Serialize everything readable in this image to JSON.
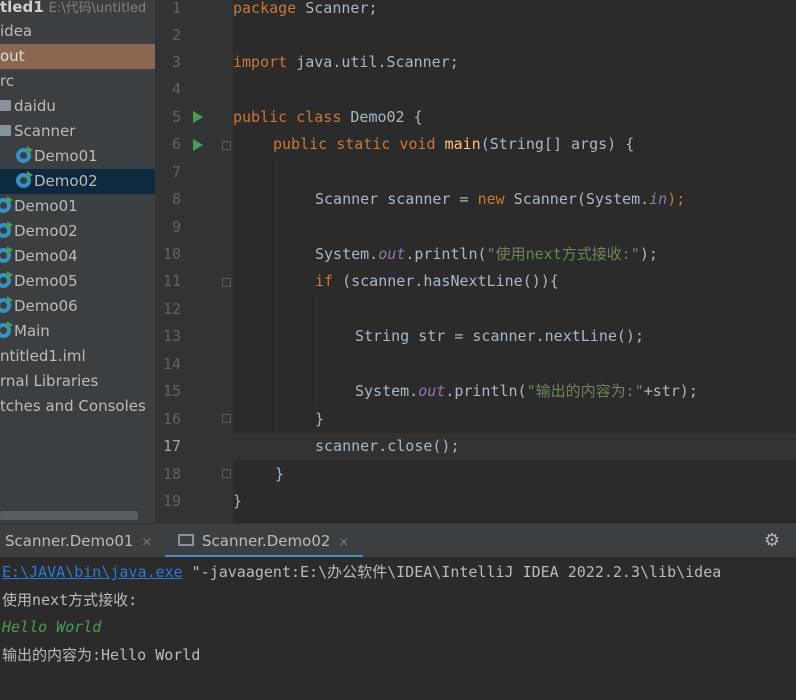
{
  "project_tree": {
    "items": [
      {
        "label": "tled1",
        "path": "E:\\代码\\untitled"
      },
      {
        "label": "idea"
      },
      {
        "label": "out"
      },
      {
        "label": "rc"
      },
      {
        "label": "daidu"
      },
      {
        "label": "Scanner"
      },
      {
        "label": "Demo01"
      },
      {
        "label": "Demo02"
      },
      {
        "label": "Demo01"
      },
      {
        "label": "Demo02"
      },
      {
        "label": "Demo04"
      },
      {
        "label": "Demo05"
      },
      {
        "label": "Demo06"
      },
      {
        "label": "Main"
      },
      {
        "label": "ntitled1.iml"
      },
      {
        "label": "rnal Libraries"
      },
      {
        "label": "tches and Consoles"
      }
    ]
  },
  "editor": {
    "line_numbers": [
      "1",
      "2",
      "3",
      "4",
      "5",
      "6",
      "7",
      "8",
      "9",
      "10",
      "11",
      "12",
      "13",
      "14",
      "15",
      "16",
      "17",
      "18",
      "19"
    ],
    "current_line": "17",
    "code": {
      "l1_kw": "package",
      "l1_rest": " Scanner;",
      "l3_kw": "import",
      "l3_rest": " java.util.Scanner;",
      "l5_kw": "public class",
      "l5_rest": " Demo02 {",
      "l6_kw": "public static void",
      "l6_fn": "main",
      "l6_rest": "(String[] args) {",
      "l8_a": "Scanner scanner = ",
      "l8_kw": "new",
      "l8_b": " Scanner(System.",
      "l8_fld": "in",
      "l8_c": ");",
      "l10_a": "System.",
      "l10_fld": "out",
      "l10_b": ".println(",
      "l10_str": "\"使用next方式接收:\"",
      "l10_c": ");",
      "l11_kw": "if",
      "l11_rest": " (scanner.hasNextLine()){",
      "l13": "String str = scanner.nextLine();",
      "l15_a": "System.",
      "l15_fld": "out",
      "l15_b": ".println(",
      "l15_str": "\"输出的内容为:\"",
      "l15_c": "+str);",
      "l16": "}",
      "l17": "scanner.close();",
      "l18": "}",
      "l19": "}"
    }
  },
  "run_window": {
    "tabs": [
      {
        "label": "Scanner.Demo01",
        "close": "×"
      },
      {
        "label": "Scanner.Demo02",
        "close": "×"
      }
    ],
    "settings_icon": "⚙",
    "output": {
      "java_path": "E:\\JAVA\\bin\\java.exe",
      "command_args": " \"-javaagent:E:\\办公软件\\IDEA\\IntelliJ IDEA 2022.2.3\\lib\\idea",
      "line2": "使用next方式接收:",
      "user_input": "Hello World",
      "line4": "输出的内容为:Hello World"
    }
  },
  "colors": {
    "keyword": "#cc7832",
    "string": "#6a8759",
    "function": "#ffc66d",
    "field": "#9876aa",
    "link": "#287bde",
    "input": "#499c54"
  }
}
